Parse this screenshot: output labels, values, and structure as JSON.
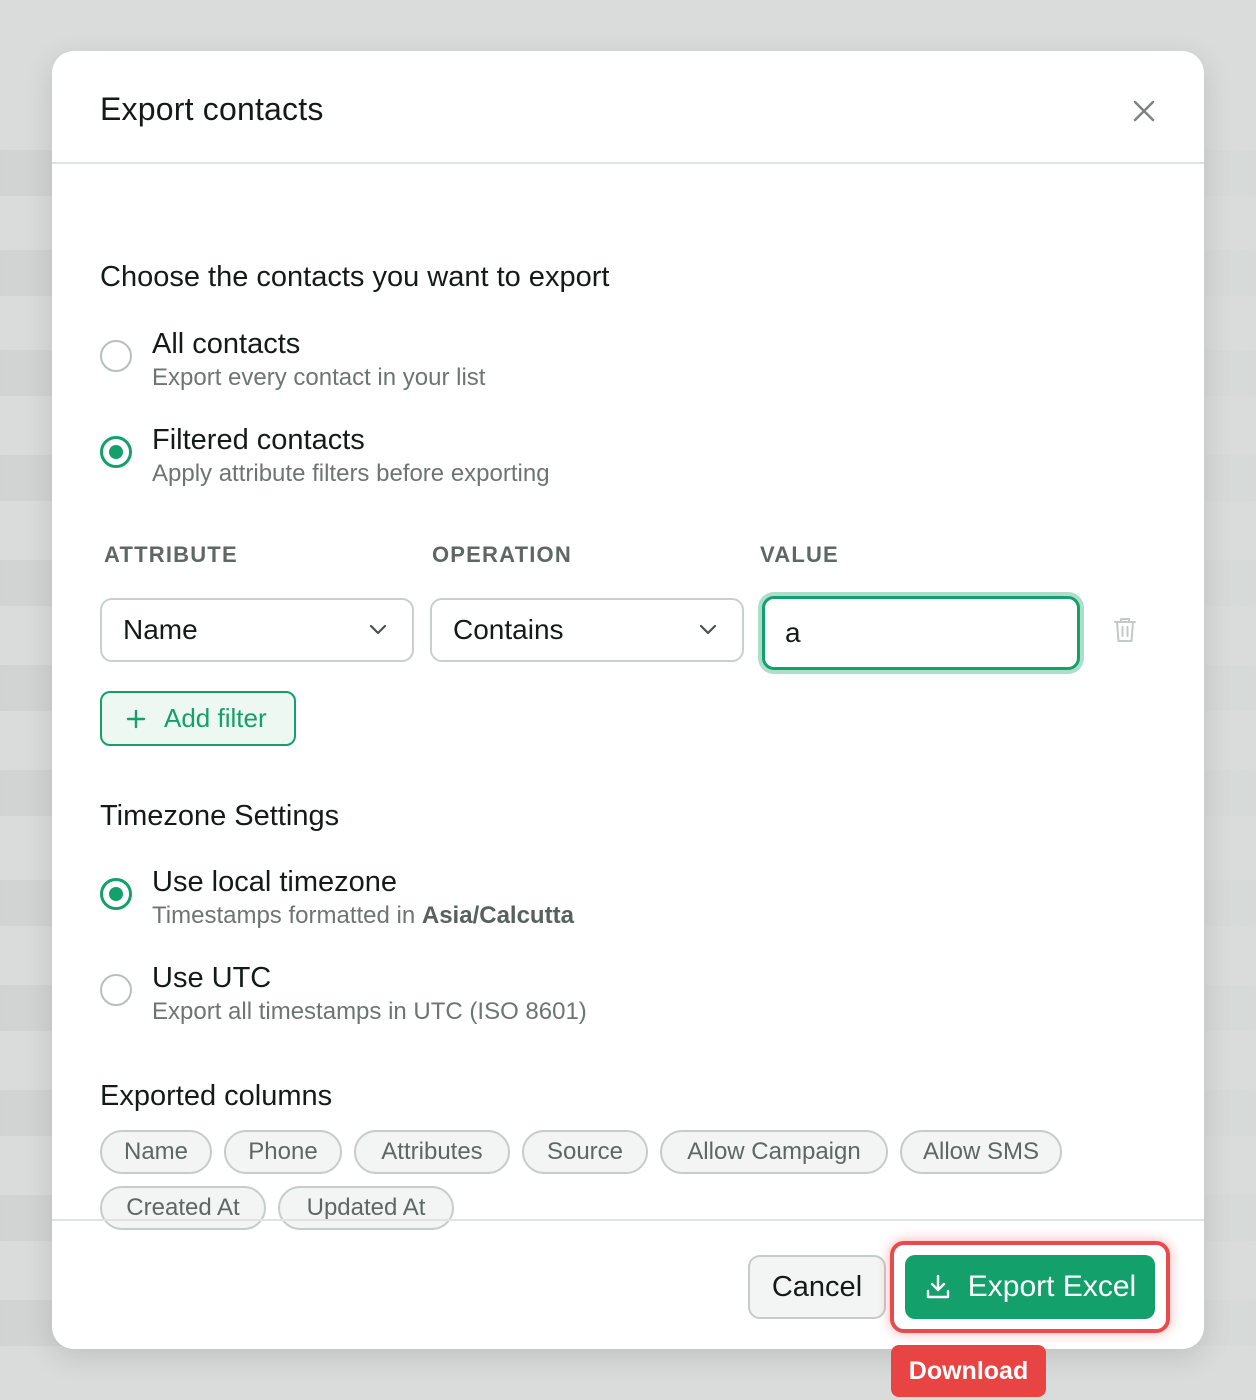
{
  "modal": {
    "title": "Export contacts"
  },
  "contacts_section": {
    "title": "Choose the contacts you want to export",
    "options": [
      {
        "label": "All contacts",
        "description": "Export every contact in your list",
        "selected": false
      },
      {
        "label": "Filtered contacts",
        "description": "Apply attribute filters before exporting",
        "selected": true
      }
    ]
  },
  "filters": {
    "headers": {
      "attribute": "ATTRIBUTE",
      "operation": "OPERATION",
      "value": "VALUE"
    },
    "rows": [
      {
        "attribute": "Name",
        "operation": "Contains",
        "value": "a"
      }
    ],
    "add_filter_label": "Add filter"
  },
  "timezone": {
    "title": "Timezone Settings",
    "options": [
      {
        "label": "Use local timezone",
        "description_prefix": "Timestamps formatted in",
        "description_bold": "Asia/Calcutta",
        "selected": true
      },
      {
        "label": "Use UTC",
        "description": "Export all timestamps in UTC (ISO 8601)",
        "selected": false
      }
    ]
  },
  "columns": {
    "title": "Exported columns",
    "chips": [
      "Name",
      "Phone",
      "Attributes",
      "Source",
      "Allow Campaign",
      "Allow SMS",
      "Created At",
      "Updated At"
    ]
  },
  "footer": {
    "cancel_label": "Cancel",
    "export_label": "Export Excel"
  },
  "tooltip": {
    "text": "Download"
  },
  "colors": {
    "accent": "#14a06a",
    "highlight": "#e84b4b",
    "tooltip": "#e84444"
  },
  "icons": {
    "close": "close-icon",
    "chevron": "chevron-down-icon",
    "delete": "trash-icon",
    "add": "plus-icon",
    "export": "download-icon"
  }
}
